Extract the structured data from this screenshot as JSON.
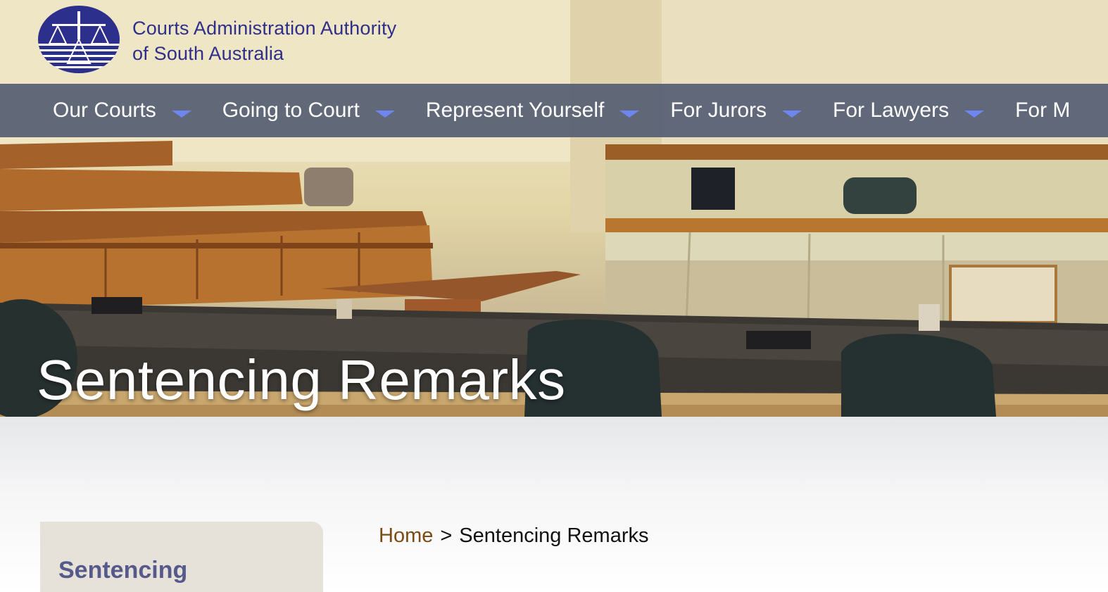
{
  "header": {
    "org_line1": "Courts Administration Authority",
    "org_line2": "of South Australia"
  },
  "nav": {
    "items": [
      {
        "label": "Our Courts"
      },
      {
        "label": "Going to Court"
      },
      {
        "label": "Represent Yourself"
      },
      {
        "label": "For Jurors"
      },
      {
        "label": "For Lawyers"
      },
      {
        "label": "For M"
      }
    ]
  },
  "hero": {
    "title": "Sentencing Remarks"
  },
  "breadcrumb": {
    "home": "Home",
    "separator": ">",
    "current": "Sentencing Remarks"
  },
  "sidebar": {
    "title": "Sentencing"
  },
  "colors": {
    "nav_bg": "#565f73",
    "nav_caret": "#6f86f2",
    "org_text": "#2f2f8a",
    "breadcrumb_link": "#7a4b12",
    "sidebar_bg": "#e6e2da",
    "sidebar_title": "#565a8a"
  },
  "icons": {
    "logo": "scales-of-justice-logo",
    "nav_caret": "chevron-down-icon"
  }
}
